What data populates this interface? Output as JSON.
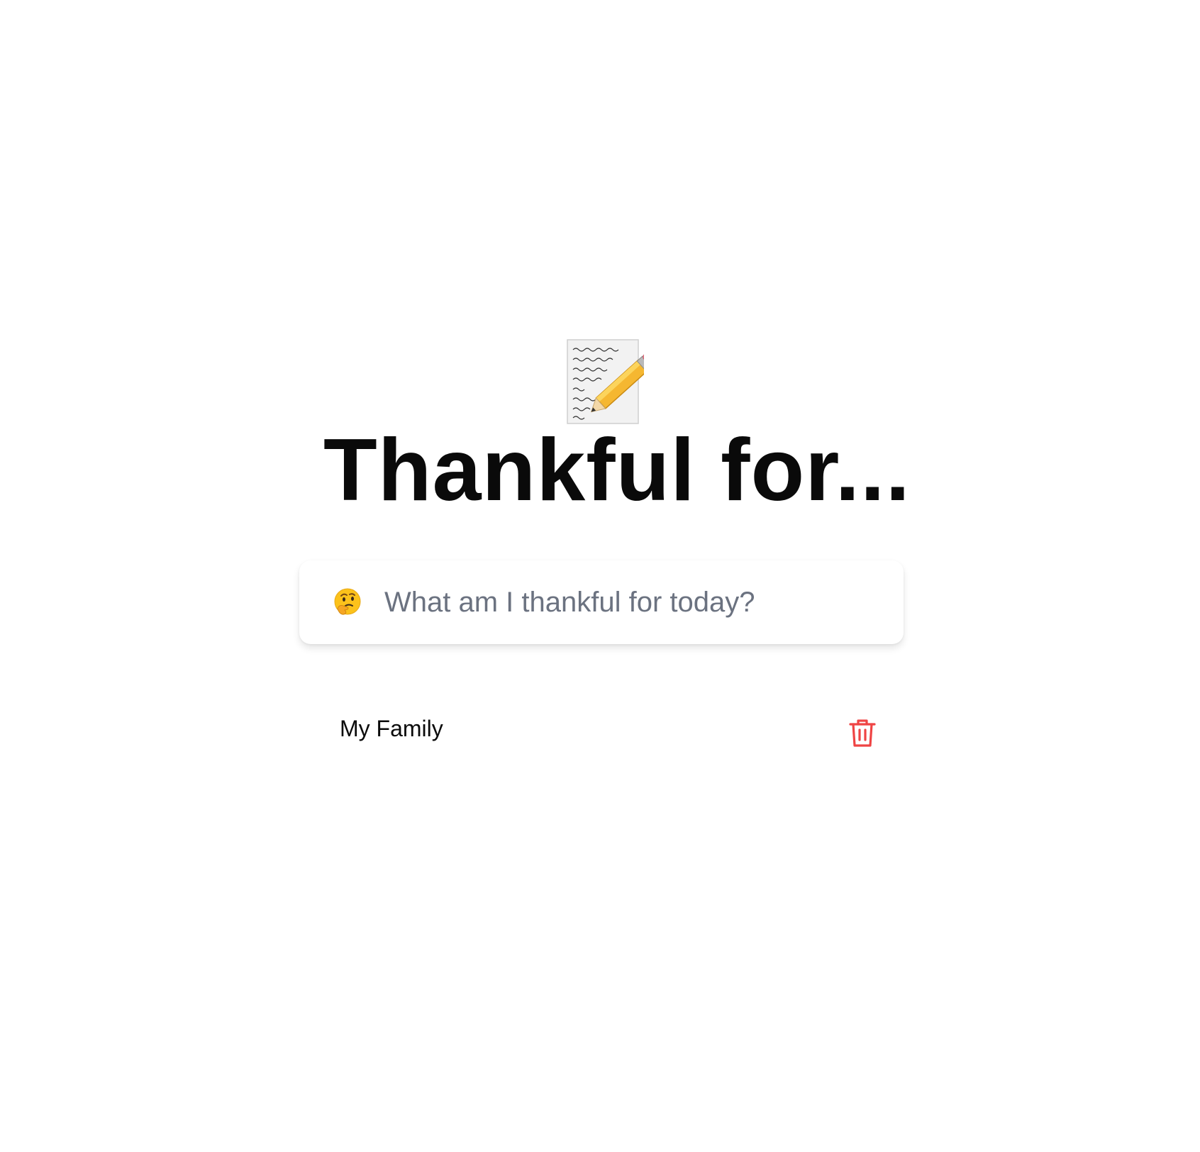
{
  "header": {
    "icon": "memo-icon",
    "title": "Thankful for..."
  },
  "entry_form": {
    "icon": "thinking-face-icon",
    "placeholder": "What am I thankful for today?",
    "value": ""
  },
  "entries": [
    {
      "text": "My Family",
      "delete_icon": "trash-icon"
    }
  ],
  "colors": {
    "title": "#0a0a0a",
    "placeholder": "#6b7280",
    "delete": "#ef4444",
    "background": "#ffffff"
  }
}
